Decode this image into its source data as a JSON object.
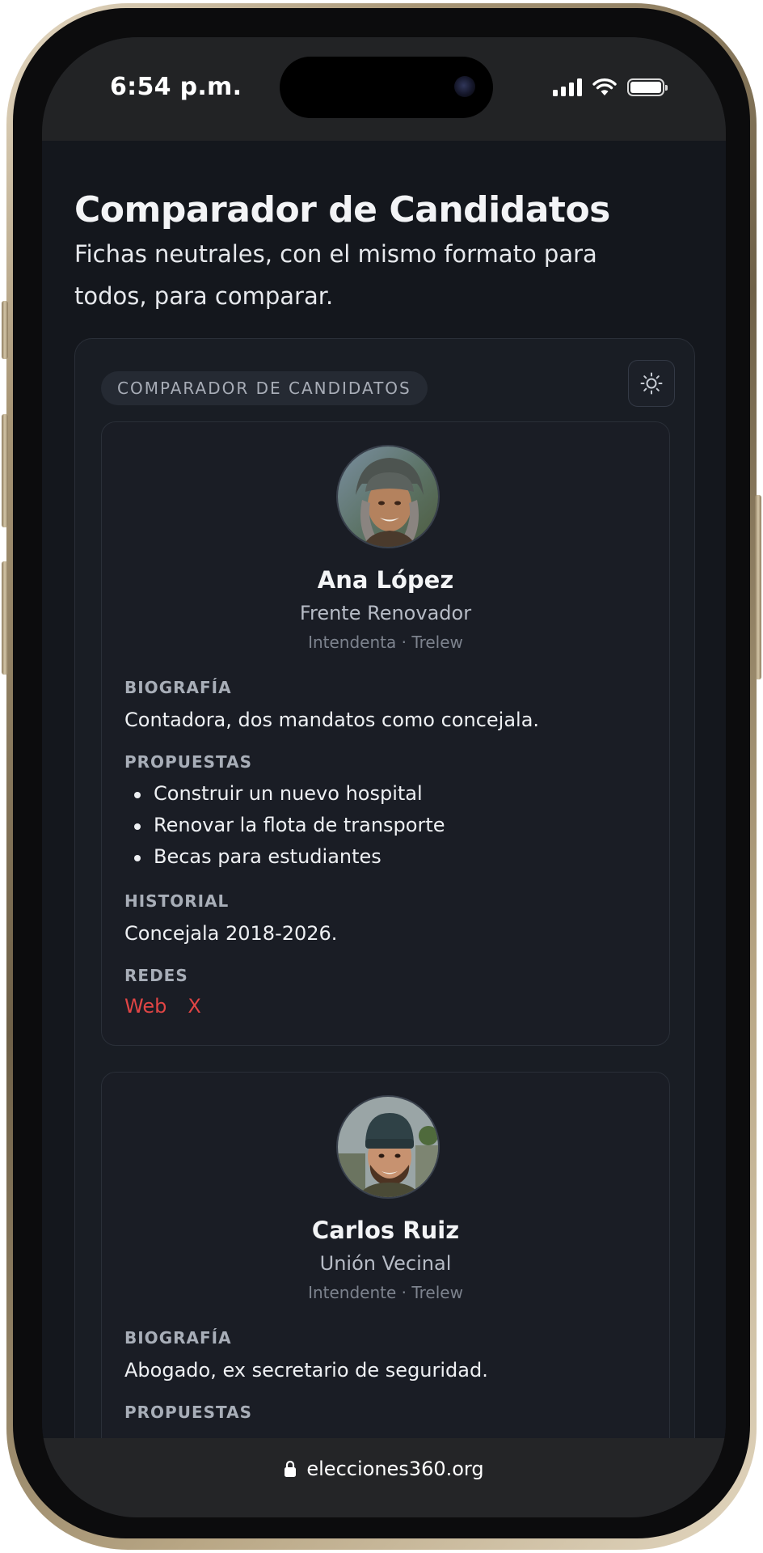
{
  "status_bar": {
    "time": "6:54 p.m."
  },
  "page": {
    "title": "Comparador de Candidatos",
    "subtitle": "Fichas neutrales, con el mismo formato para todos, para comparar."
  },
  "widget": {
    "tag": "COMPARADOR DE CANDIDATOS",
    "theme_icon": "sun-icon"
  },
  "candidates": [
    {
      "name": "Ana López",
      "party": "Frente Renovador",
      "role": "Intendenta · Trelew",
      "bio_label": "BIOGRAFÍA",
      "bio": "Contadora, dos mandatos como concejala.",
      "proposals_label": "PROPUESTAS",
      "proposals": [
        "Construir un nuevo hospital",
        "Renovar la flota de transporte",
        "Becas para estudiantes"
      ],
      "history_label": "HISTORIAL",
      "history": "Concejala 2018-2026.",
      "networks_label": "REDES",
      "networks": [
        "Web",
        "X"
      ]
    },
    {
      "name": "Carlos Ruiz",
      "party": "Unión Vecinal",
      "role": "Intendente · Trelew",
      "bio_label": "BIOGRAFÍA",
      "bio": "Abogado, ex secretario de seguridad.",
      "proposals_label": "PROPUESTAS"
    }
  ],
  "url_bar": {
    "url": "elecciones360.org",
    "icon": "lock-icon"
  },
  "colors": {
    "link": "#e04545",
    "background": "#14171d",
    "card": "#1a1d25"
  }
}
